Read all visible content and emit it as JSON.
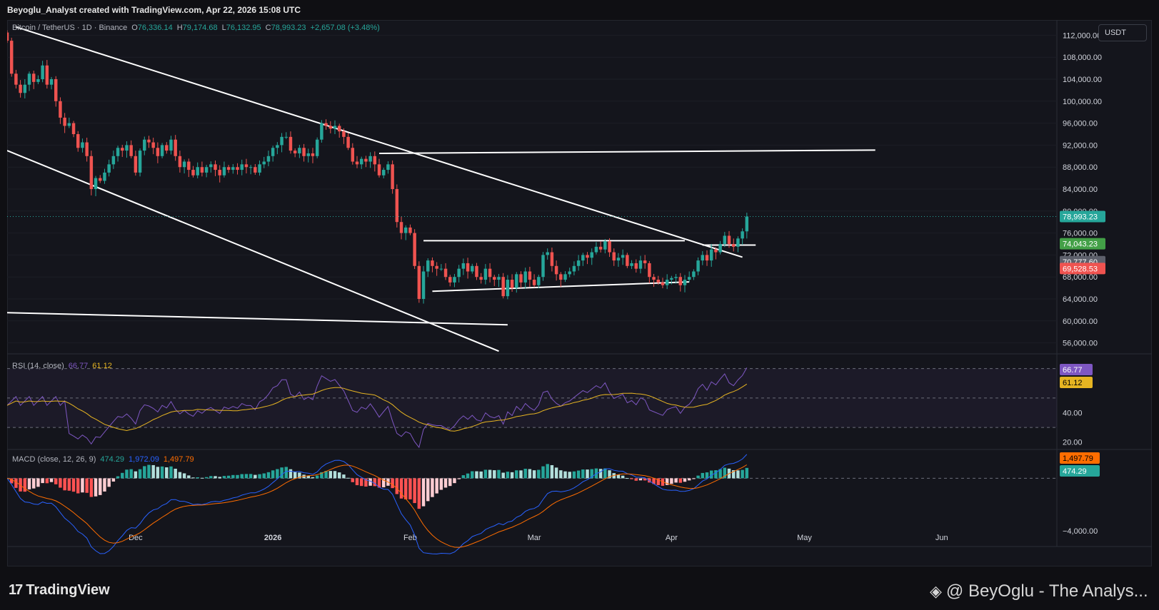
{
  "header": {
    "attribution": "Beyoglu_Analyst created with TradingView.com, Apr 22, 2026 15:08 UTC"
  },
  "legend": {
    "symbol": "Bitcoin / TetherUS · 1D · Binance",
    "open_label": "O",
    "open": "76,336.14",
    "high_label": "H",
    "high": "79,174.68",
    "low_label": "L",
    "low": "76,132.95",
    "close_label": "C",
    "close": "78,993.23",
    "change": "+2,657.08 (+3.48%)"
  },
  "currency": "USDT",
  "rsi_legend": {
    "label": "RSI (14, close)",
    "rsi": "66.77",
    "ma": "61.12"
  },
  "macd_legend": {
    "label": "MACD (close, 12, 26, 9)",
    "hist": "474.29",
    "macd": "1,972.09",
    "signal": "1,497.79"
  },
  "branding": {
    "logo_text": "TradingView",
    "logo_mark": "17",
    "watermark": "@ BeyOglu - The Analys..."
  },
  "colors": {
    "up": "#26a69a",
    "down": "#ef5350",
    "rsi_line": "#7e57c2",
    "rsi_ma": "#e6b422",
    "macd_line": "#2962ff",
    "signal_line": "#ff6d00",
    "line_drawings": "#ffffff"
  },
  "chart_data": [
    {
      "type": "candlestick",
      "title": "Bitcoin / TetherUS · 1D · Binance",
      "ylim": [
        54000,
        114000
      ],
      "y_ticks": [
        "112,000.00",
        "108,000.00",
        "104,000.00",
        "100,000.00",
        "96,000.00",
        "92,000.00",
        "88,000.00",
        "84,000.00",
        "80,000.00",
        "76,000.00",
        "72,000.00",
        "68,000.00",
        "64,000.00",
        "60,000.00",
        "56,000.00"
      ],
      "x_ticks": [
        "Dec",
        "2026",
        "Feb",
        "Mar",
        "Apr",
        "May",
        "Jun"
      ],
      "x_ticks_dates": [
        "2025-12-01",
        "2026-01-01",
        "2026-02-01",
        "2026-03-01",
        "2026-04-01",
        "2026-05-01",
        "2026-06-01"
      ],
      "x_range": [
        "2025-11-02",
        "2026-06-27"
      ],
      "start_date": "2025-11-02",
      "closes": [
        111000,
        105000,
        103000,
        101500,
        103000,
        105000,
        103500,
        104000,
        106500,
        103000,
        104000,
        100000,
        97000,
        95500,
        96000,
        94000,
        91500,
        92500,
        90000,
        84000,
        86000,
        85500,
        87000,
        88500,
        90000,
        91500,
        91000,
        92000,
        90000,
        87000,
        91000,
        93000,
        92500,
        91500,
        90000,
        92000,
        91000,
        93000,
        90000,
        88000,
        89000,
        87500,
        86500,
        88000,
        87000,
        88000,
        88500,
        87500,
        86500,
        88000,
        87500,
        88000,
        87500,
        88500,
        88000,
        88000,
        87000,
        88500,
        89000,
        90000,
        91500,
        92000,
        93500,
        93500,
        91000,
        90500,
        91500,
        90000,
        90500,
        90000,
        93000,
        96000,
        95500,
        95000,
        95500,
        94500,
        93500,
        91500,
        89000,
        88500,
        89500,
        89000,
        90000,
        88500,
        86500,
        87500,
        88500,
        84000,
        78000,
        76000,
        77000,
        76000,
        70000,
        64000,
        69000,
        71000,
        70000,
        69500,
        69500,
        68000,
        67000,
        68000,
        69500,
        70500,
        69000,
        70000,
        68000,
        67500,
        69500,
        68000,
        67500,
        68000,
        64500,
        67500,
        66000,
        68500,
        67000,
        69000,
        67500,
        66500,
        68000,
        72000,
        72500,
        70000,
        68500,
        67500,
        68500,
        69000,
        70000,
        71000,
        72000,
        71500,
        72500,
        73500,
        73000,
        74500,
        72500,
        71000,
        71500,
        72000,
        70000,
        70500,
        69500,
        71000,
        70500,
        68000,
        67500,
        67000,
        66500,
        67500,
        67800,
        68000,
        66500,
        67500,
        68000,
        69000,
        71000,
        72000,
        71000,
        73000,
        72500,
        74000,
        75500,
        74000,
        73500,
        75000,
        76300,
        79000
      ],
      "y_extra_labels": [
        "78,993.23",
        "74,043.23",
        "70,777.60",
        "69,528.53"
      ],
      "trend_lines": [
        {
          "from": [
            "2025-11-04",
            113500
          ],
          "to": [
            "2026-04-17",
            71600
          ]
        },
        {
          "from": [
            "2025-11-02",
            91000
          ],
          "to": [
            "2026-02-21",
            54500
          ]
        },
        {
          "from": [
            "2025-11-02",
            61500
          ],
          "to": [
            "2026-02-23",
            59300
          ]
        },
        {
          "from": [
            "2026-01-25",
            90500
          ],
          "to": [
            "2026-05-17",
            91100
          ]
        },
        {
          "from": [
            "2026-02-04",
            74600
          ],
          "to": [
            "2026-04-04",
            74600
          ]
        },
        {
          "from": [
            "2026-02-06",
            65400
          ],
          "to": [
            "2026-04-05",
            67100
          ]
        },
        {
          "from": [
            "2026-04-08",
            73800
          ],
          "to": [
            "2026-04-20",
            73800
          ]
        }
      ]
    },
    {
      "type": "line",
      "title": "RSI (14, close)",
      "ylim": [
        15,
        80
      ],
      "y_ticks": [
        "40.00",
        "20.00"
      ],
      "guide_levels": [
        70,
        50,
        30
      ],
      "series": [
        {
          "name": "RSI"
        },
        {
          "name": "RSI-based MA"
        }
      ],
      "last": {
        "rsi": 66.77,
        "ma": 61.12
      }
    },
    {
      "type": "bar",
      "title": "MACD (close, 12, 26, 9)",
      "ylim": [
        -5200,
        2200
      ],
      "y_ticks": [
        "−4,000.00"
      ],
      "series": [
        {
          "name": "Histogram"
        },
        {
          "name": "MACD"
        },
        {
          "name": "Signal"
        }
      ],
      "last": {
        "hist": 474.29,
        "macd": 1972.09,
        "signal": 1497.79
      }
    }
  ]
}
